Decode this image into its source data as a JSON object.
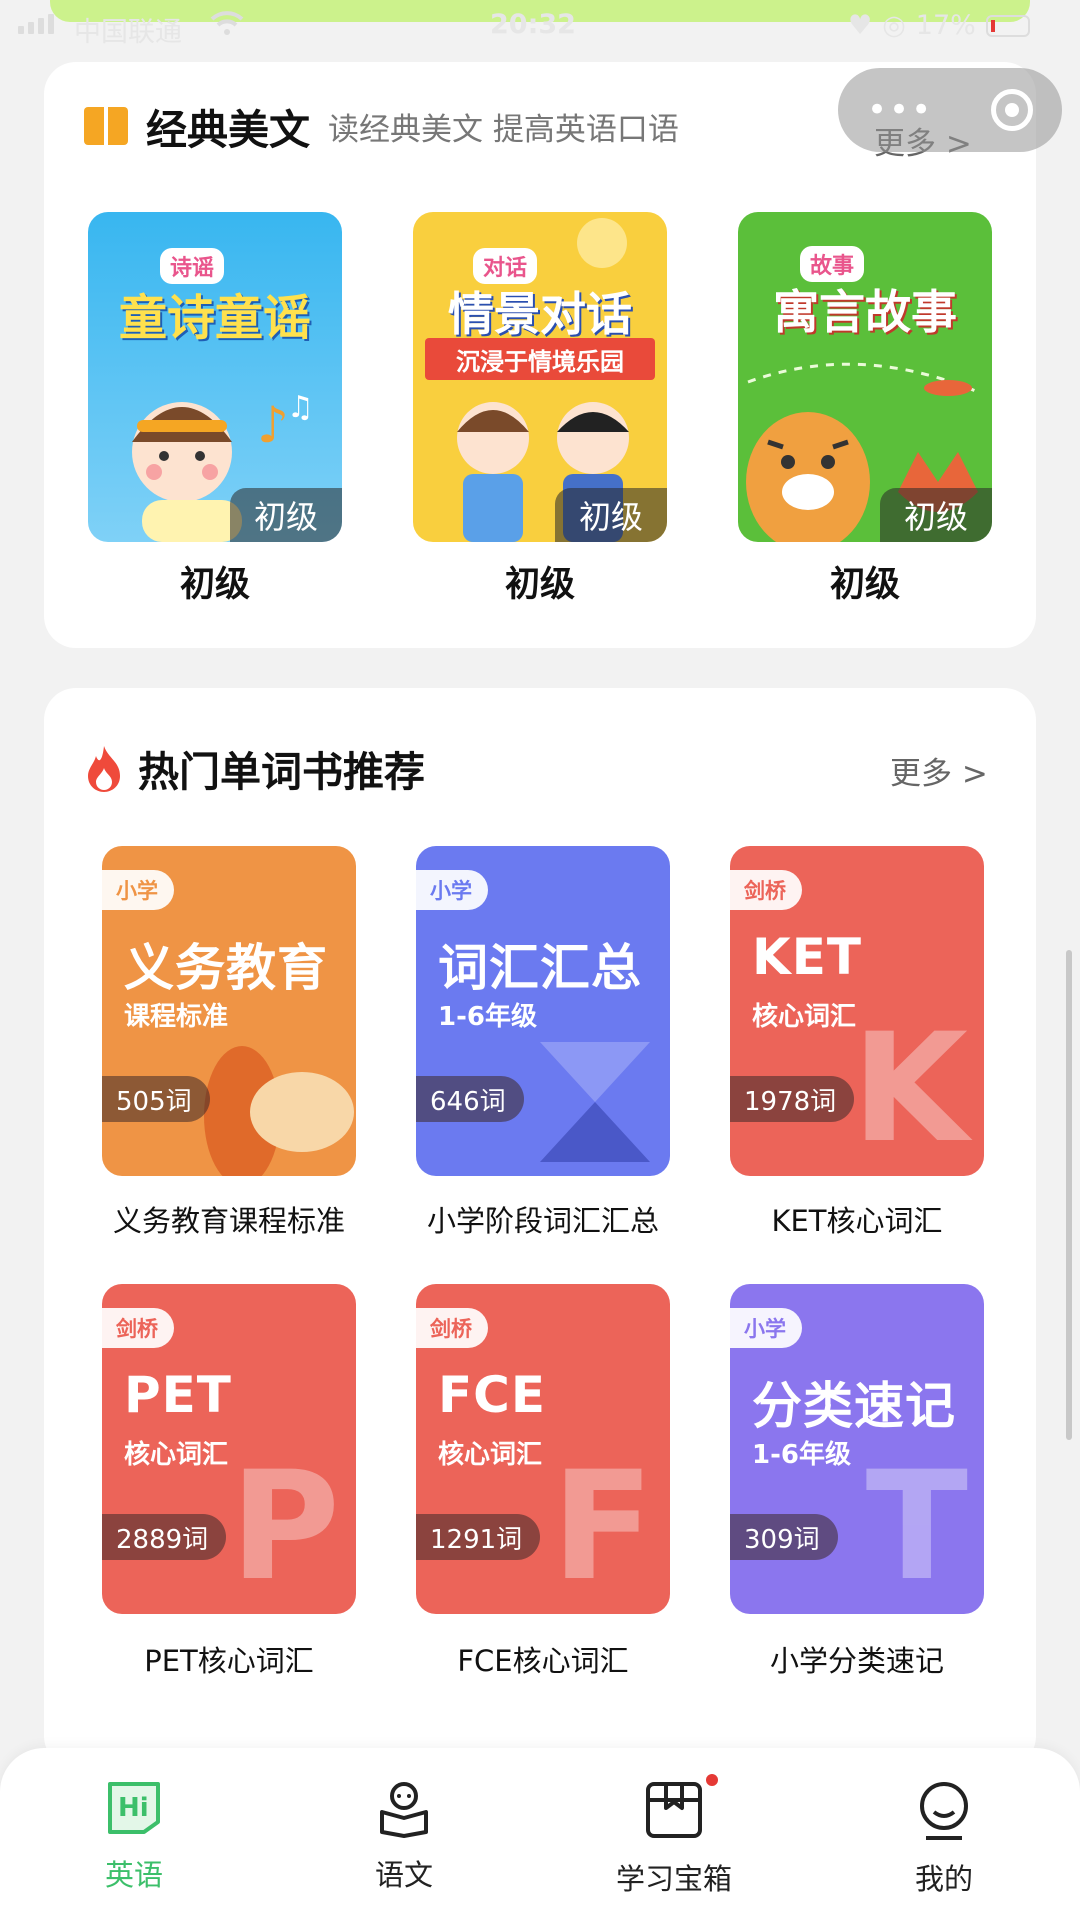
{
  "status_bar": {
    "carrier": "中国联通",
    "time": "20:32",
    "battery": "17%"
  },
  "classics": {
    "title": "经典美文",
    "subtitle": "读经典美文 提高英语口语",
    "more_label": "更多 >",
    "items": [
      {
        "cover_tag": "诗谣",
        "cover_title": "童诗童谣",
        "badge": "初级",
        "caption": "初级"
      },
      {
        "cover_tag": "对话",
        "cover_title": "情景对话",
        "cover_sub": "沉浸于情境乐园",
        "badge": "初级",
        "caption": "初级"
      },
      {
        "cover_tag": "故事",
        "cover_title": "寓言故事",
        "badge": "初级",
        "caption": "初级"
      }
    ]
  },
  "wordbooks": {
    "title": "热门单词书推荐",
    "more_label": "更多 >",
    "items": [
      {
        "tag": "小学",
        "big": "义务教育",
        "small": "课程标准",
        "count": "505词",
        "caption": "义务教育课程标准",
        "letter": "",
        "color": "#ef9445"
      },
      {
        "tag": "小学",
        "big": "词汇汇总",
        "small": "1-6年级",
        "count": "646词",
        "caption": "小学阶段词汇汇总",
        "letter": "",
        "color": "#6b7af0"
      },
      {
        "tag": "剑桥",
        "big": "KET",
        "small": "核心词汇",
        "count": "1978词",
        "caption": "KET核心词汇",
        "letter": "K",
        "color": "#ec6459"
      },
      {
        "tag": "剑桥",
        "big": "PET",
        "small": "核心词汇",
        "count": "2889词",
        "caption": "PET核心词汇",
        "letter": "P",
        "color": "#ec6459"
      },
      {
        "tag": "剑桥",
        "big": "FCE",
        "small": "核心词汇",
        "count": "1291词",
        "caption": "FCE核心词汇",
        "letter": "F",
        "color": "#ec6459"
      },
      {
        "tag": "小学",
        "big": "分类速记",
        "small": "1-6年级",
        "count": "309词",
        "caption": "小学分类速记",
        "letter": "T",
        "color": "#8b76ee"
      }
    ]
  },
  "tabbar": {
    "items": [
      {
        "label": "英语",
        "icon": "hi-icon",
        "active": true
      },
      {
        "label": "语文",
        "icon": "reader-icon",
        "active": false
      },
      {
        "label": "学习宝箱",
        "icon": "box-icon",
        "active": false
      },
      {
        "label": "我的",
        "icon": "profile-icon",
        "active": false
      }
    ]
  }
}
